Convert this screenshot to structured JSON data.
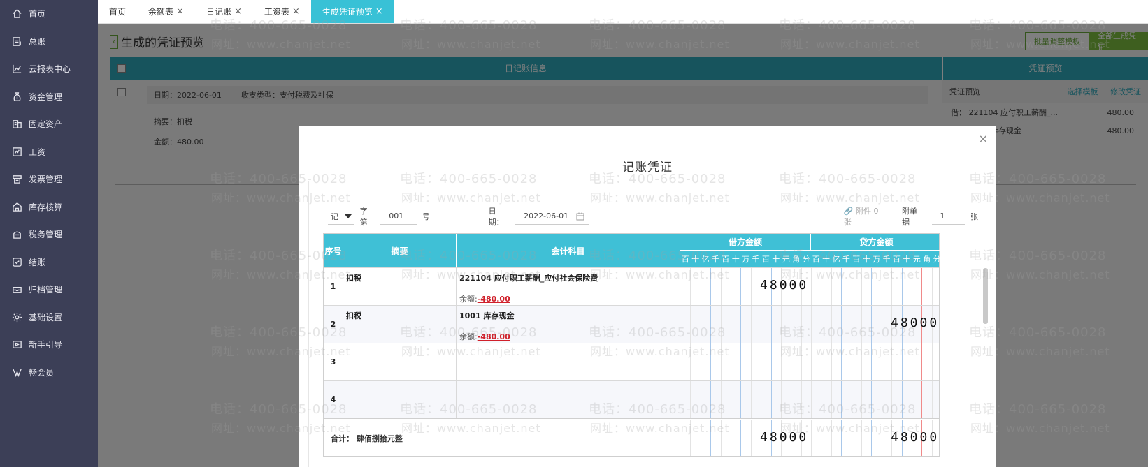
{
  "sidebar": {
    "items": [
      {
        "label": "首页",
        "icon": "home-icon"
      },
      {
        "label": "总账",
        "icon": "ledger-icon"
      },
      {
        "label": "云报表中心",
        "icon": "chart-icon"
      },
      {
        "label": "资金管理",
        "icon": "money-bag-icon"
      },
      {
        "label": "固定资产",
        "icon": "building-icon"
      },
      {
        "label": "工资",
        "icon": "salary-icon"
      },
      {
        "label": "发票管理",
        "icon": "invoice-icon"
      },
      {
        "label": "库存核算",
        "icon": "warehouse-icon"
      },
      {
        "label": "税务管理",
        "icon": "tax-icon"
      },
      {
        "label": "结账",
        "icon": "close-books-icon"
      },
      {
        "label": "归档管理",
        "icon": "archive-icon"
      },
      {
        "label": "基础设置",
        "icon": "gear-icon"
      },
      {
        "label": "新手引导",
        "icon": "guide-icon"
      },
      {
        "label": "畅会员",
        "icon": "vip-icon"
      }
    ]
  },
  "tabs": [
    {
      "label": "首页",
      "closable": false
    },
    {
      "label": "余额表",
      "closable": true
    },
    {
      "label": "日记账",
      "closable": true
    },
    {
      "label": "工资表",
      "closable": true
    },
    {
      "label": "生成凭证预览",
      "closable": true,
      "active": true
    }
  ],
  "page": {
    "title": "生成的凭证预览",
    "batch_button": "批量调整模板",
    "generate_all_button": "全部生成凭证",
    "grid_header_left": "日记账信息",
    "grid_header_right": "凭证预览",
    "entry": {
      "date": "日期：2022-06-01",
      "type": "收支类型：支付税费及社保",
      "summary": "摘要：扣税",
      "amount": "金额：480.00"
    },
    "preview": {
      "head_label": "凭证预览",
      "select_template": "选择模板",
      "modify_voucher": "修改凭证",
      "lines": [
        {
          "text": "借：  221104 应付职工薪酬_...",
          "amount": "480.00"
        },
        {
          "text": "贷：  1001 库存现金",
          "amount": "480.00"
        }
      ]
    }
  },
  "watermark": {
    "phone": "电话：400-665-0028",
    "site": "网址：www.chanjet.net"
  },
  "modal": {
    "title": "记账凭证",
    "close": "×",
    "voucher_word": "记",
    "word_label": "字第",
    "number": "001",
    "number_suffix": "号",
    "date_label": "日期：",
    "date": "2022-06-01",
    "attachment": "附件 0 张",
    "attach_label": "附单据",
    "attach_count": "1",
    "attach_unit": "张",
    "columns": {
      "index": "序号",
      "summary": "摘要",
      "account": "会计科目",
      "debit": "借方金额",
      "credit": "贷方金额",
      "units": [
        "百",
        "十",
        "亿",
        "千",
        "百",
        "十",
        "万",
        "千",
        "百",
        "十",
        "元",
        "角",
        "分"
      ]
    },
    "rows": [
      {
        "index": "1",
        "summary": "扣税",
        "account": "221104 应付职工薪酬_应付社会保险费",
        "balance_label": "余额:",
        "balance": "-480.00",
        "debit": "48000",
        "credit": ""
      },
      {
        "index": "2",
        "summary": "扣税",
        "account": "1001 库存现金",
        "balance_label": "余额:",
        "balance": "-480.00",
        "debit": "",
        "credit": "48000"
      },
      {
        "index": "3",
        "summary": "",
        "account": "",
        "balance_label": "",
        "balance": "",
        "debit": "",
        "credit": ""
      },
      {
        "index": "4",
        "summary": "",
        "account": "",
        "balance_label": "",
        "balance": "",
        "debit": "",
        "credit": ""
      }
    ],
    "total_label": "合计：",
    "total_words": "肆佰捌拾元整",
    "total_debit": "48000",
    "total_credit": "48000"
  },
  "colors": {
    "sidebar": "#3c3f57",
    "accent": "#38c1d6",
    "green": "#7cbf3e",
    "red": "#d0202a"
  }
}
